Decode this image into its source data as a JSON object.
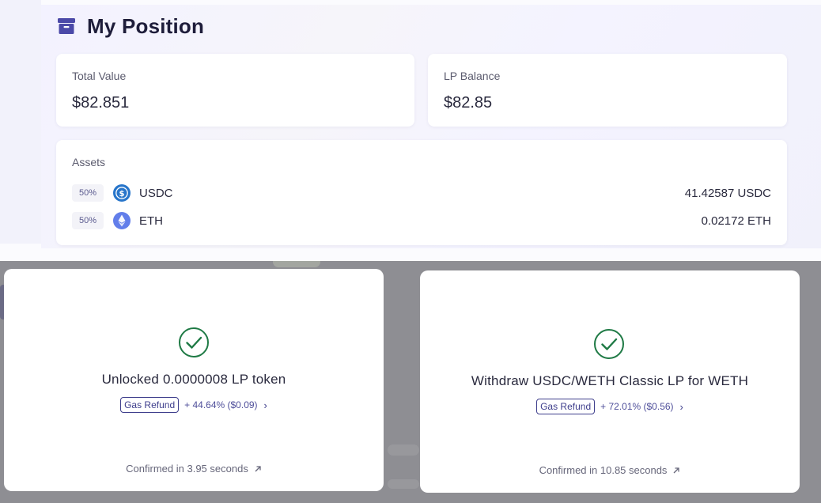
{
  "header": {
    "title": "My Position",
    "icon": "archive-box-icon",
    "icon_color": "#4b49a8"
  },
  "total_value": {
    "label": "Total Value",
    "value": "$82.851"
  },
  "lp_balance": {
    "label": "LP Balance",
    "value": "$82.85"
  },
  "assets": {
    "label": "Assets",
    "items": [
      {
        "percent": "50%",
        "symbol": "USDC",
        "amount": "41.42587 USDC",
        "icon": "usdc-icon",
        "icon_color": "#2775ca"
      },
      {
        "percent": "50%",
        "symbol": "ETH",
        "amount": "0.02172 ETH",
        "icon": "eth-icon",
        "icon_color": "#627eea"
      }
    ]
  },
  "modals": [
    {
      "title": "Unlocked 0.0000008 LP token",
      "badge": "Gas Refund",
      "refund": "+ 44.64% ($0.09)",
      "confirmed": "Confirmed in 3.95 seconds"
    },
    {
      "title": "Withdraw USDC/WETH Classic LP for WETH",
      "badge": "Gas Refund",
      "refund": "+ 72.01% ($0.56)",
      "confirmed": "Confirmed in 10.85 seconds"
    }
  ],
  "colors": {
    "success": "#1f7a45",
    "accent": "#3e3e8c",
    "overlay": "#8e8e93"
  }
}
